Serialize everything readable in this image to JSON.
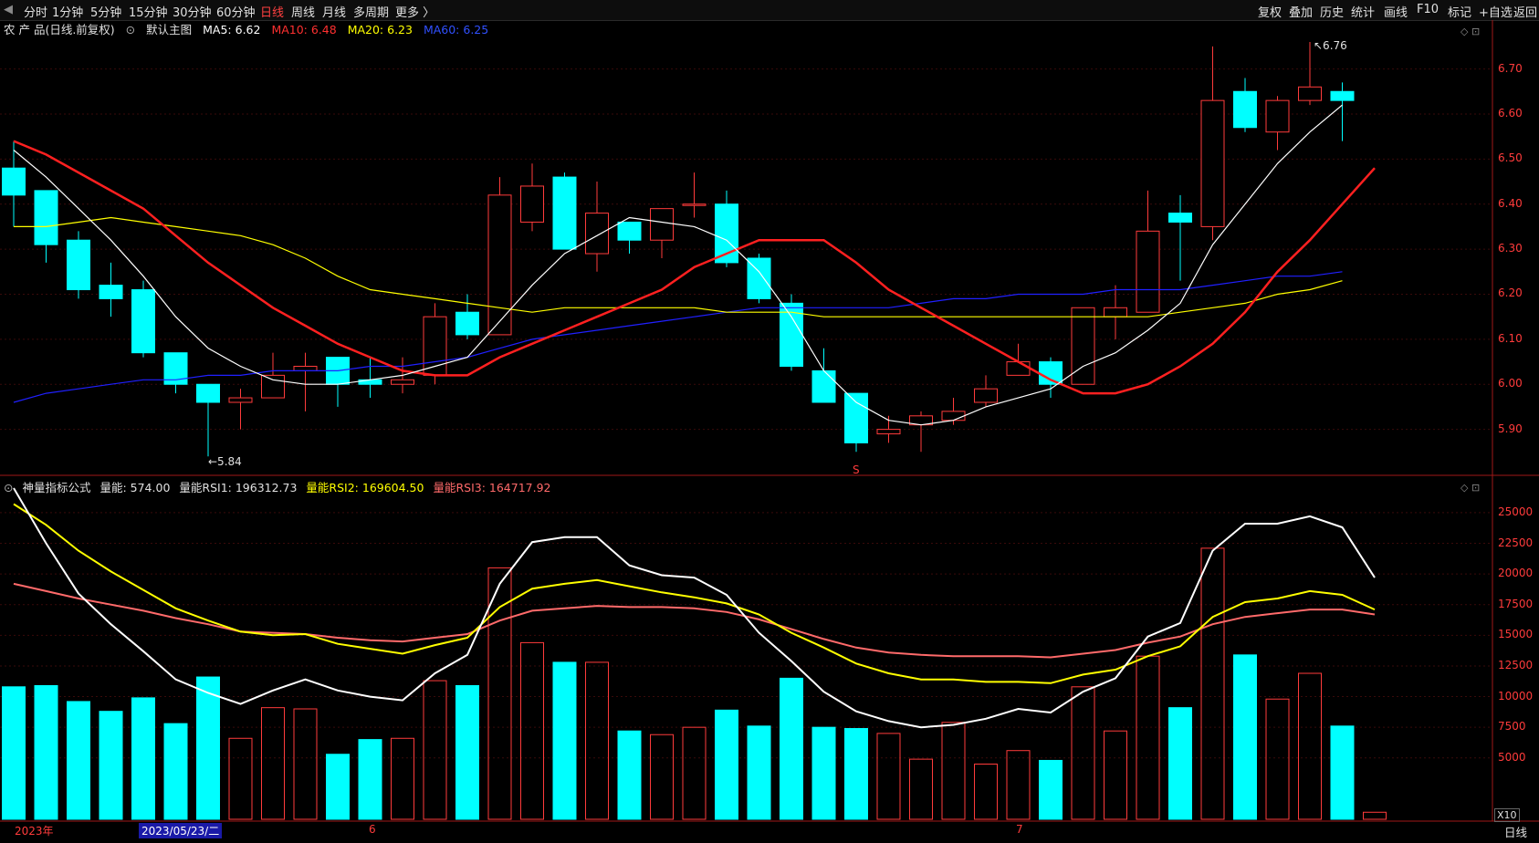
{
  "toolbar": {
    "left_items": [
      "分时",
      "1分钟",
      "5分钟",
      "15分钟",
      "30分钟",
      "60分钟",
      "日线",
      "周线",
      "月线",
      "多周期",
      "更多 〉"
    ],
    "active": "日线",
    "right_items": [
      "复权",
      "叠加",
      "历史",
      "统计",
      "画线",
      "F10",
      "标记",
      "+自选",
      "返回"
    ]
  },
  "info": {
    "stock": "农 产 品(日线.前复权)",
    "main_chart": "默认主图",
    "ma5": "MA5: 6.62",
    "ma10": "MA10: 6.48",
    "ma20": "MA20: 6.23",
    "ma60": "MA60: 6.25"
  },
  "volume_info": {
    "name": "神量指标公式",
    "vol": "量能: 574.00",
    "rsi1": "量能RSI1: 196312.73",
    "rsi2": "量能RSI2: 169604.50",
    "rsi3": "量能RSI3: 164717.92"
  },
  "colors": {
    "up": "#ff3b3b",
    "down": "#00ffff",
    "ma5": "#ffffff",
    "ma10": "#ff2020",
    "ma20": "#ffff00",
    "ma60": "#2020ff",
    "rsi1": "#ffffff",
    "rsi2": "#ffff00",
    "rsi3": "#ff6a6a"
  },
  "axis": {
    "price_ticks": [
      "6.70",
      "6.60",
      "6.50",
      "6.40",
      "6.30",
      "6.20",
      "6.10",
      "6.00",
      "5.90"
    ],
    "volume_ticks": [
      "25000",
      "22500",
      "20000",
      "17500",
      "15000",
      "12500",
      "10000",
      "7500",
      "5000"
    ],
    "x_labels": [
      "2023年",
      "2023/05/23/二",
      "6",
      "7"
    ],
    "vol_scale": "X10",
    "period": "日线"
  },
  "annotations": {
    "high": "6.76",
    "low": "5.84",
    "marker": "S"
  },
  "chart_data": [
    {
      "type": "candlestick",
      "title": "农 产 品(日线.前复权)",
      "ylim": [
        5.8,
        6.77
      ],
      "candles": [
        {
          "o": 6.48,
          "h": 6.54,
          "l": 6.35,
          "c": 6.42
        },
        {
          "o": 6.43,
          "h": 6.43,
          "l": 6.27,
          "c": 6.31
        },
        {
          "o": 6.32,
          "h": 6.34,
          "l": 6.19,
          "c": 6.21
        },
        {
          "o": 6.22,
          "h": 6.27,
          "l": 6.15,
          "c": 6.19
        },
        {
          "o": 6.21,
          "h": 6.23,
          "l": 6.06,
          "c": 6.07
        },
        {
          "o": 6.07,
          "h": 6.07,
          "l": 5.98,
          "c": 6.0
        },
        {
          "o": 6.0,
          "h": 6.0,
          "l": 5.84,
          "c": 5.96
        },
        {
          "o": 5.96,
          "h": 5.99,
          "l": 5.9,
          "c": 5.97
        },
        {
          "o": 5.97,
          "h": 6.07,
          "l": 5.97,
          "c": 6.02
        },
        {
          "o": 6.03,
          "h": 6.07,
          "l": 5.94,
          "c": 6.04
        },
        {
          "o": 6.06,
          "h": 6.06,
          "l": 5.95,
          "c": 6.0
        },
        {
          "o": 6.01,
          "h": 6.06,
          "l": 5.97,
          "c": 6.0
        },
        {
          "o": 6.0,
          "h": 6.06,
          "l": 5.98,
          "c": 6.01
        },
        {
          "o": 6.02,
          "h": 6.18,
          "l": 6.0,
          "c": 6.15
        },
        {
          "o": 6.16,
          "h": 6.2,
          "l": 6.1,
          "c": 6.11
        },
        {
          "o": 6.11,
          "h": 6.46,
          "l": 6.11,
          "c": 6.42
        },
        {
          "o": 6.36,
          "h": 6.49,
          "l": 6.34,
          "c": 6.44
        },
        {
          "o": 6.46,
          "h": 6.47,
          "l": 6.3,
          "c": 6.3
        },
        {
          "o": 6.29,
          "h": 6.45,
          "l": 6.25,
          "c": 6.38
        },
        {
          "o": 6.36,
          "h": 6.36,
          "l": 6.29,
          "c": 6.32
        },
        {
          "o": 6.32,
          "h": 6.39,
          "l": 6.28,
          "c": 6.39
        },
        {
          "o": 6.4,
          "h": 6.47,
          "l": 6.37,
          "c": 6.4
        },
        {
          "o": 6.4,
          "h": 6.43,
          "l": 6.26,
          "c": 6.27
        },
        {
          "o": 6.28,
          "h": 6.29,
          "l": 6.18,
          "c": 6.19
        },
        {
          "o": 6.18,
          "h": 6.2,
          "l": 6.03,
          "c": 6.04
        },
        {
          "o": 6.03,
          "h": 6.08,
          "l": 5.96,
          "c": 5.96
        },
        {
          "o": 5.98,
          "h": 5.98,
          "l": 5.85,
          "c": 5.87
        },
        {
          "o": 5.89,
          "h": 5.93,
          "l": 5.87,
          "c": 5.9
        },
        {
          "o": 5.91,
          "h": 5.94,
          "l": 5.85,
          "c": 5.93
        },
        {
          "o": 5.92,
          "h": 5.97,
          "l": 5.91,
          "c": 5.94
        },
        {
          "o": 5.96,
          "h": 6.02,
          "l": 5.95,
          "c": 5.99
        },
        {
          "o": 6.02,
          "h": 6.09,
          "l": 6.02,
          "c": 6.05
        },
        {
          "o": 6.05,
          "h": 6.06,
          "l": 5.97,
          "c": 6.0
        },
        {
          "o": 6.0,
          "h": 6.17,
          "l": 6.0,
          "c": 6.17
        },
        {
          "o": 6.15,
          "h": 6.22,
          "l": 6.1,
          "c": 6.17
        },
        {
          "o": 6.16,
          "h": 6.43,
          "l": 6.16,
          "c": 6.34
        },
        {
          "o": 6.38,
          "h": 6.42,
          "l": 6.23,
          "c": 6.36
        },
        {
          "o": 6.35,
          "h": 6.75,
          "l": 6.32,
          "c": 6.63
        },
        {
          "o": 6.65,
          "h": 6.68,
          "l": 6.56,
          "c": 6.57
        },
        {
          "o": 6.56,
          "h": 6.64,
          "l": 6.52,
          "c": 6.63
        },
        {
          "o": 6.63,
          "h": 6.76,
          "l": 6.62,
          "c": 6.66
        },
        {
          "o": 6.65,
          "h": 6.67,
          "l": 6.54,
          "c": 6.63
        }
      ],
      "ma5": [
        6.52,
        6.46,
        6.39,
        6.32,
        6.24,
        6.15,
        6.08,
        6.04,
        6.01,
        6.0,
        6.0,
        6.01,
        6.02,
        6.04,
        6.06,
        6.14,
        6.22,
        6.29,
        6.33,
        6.37,
        6.36,
        6.35,
        6.32,
        6.25,
        6.15,
        6.03,
        5.96,
        5.92,
        5.91,
        5.92,
        5.95,
        5.97,
        5.99,
        6.04,
        6.07,
        6.12,
        6.18,
        6.31,
        6.4,
        6.49,
        6.56,
        6.62
      ],
      "ma10": [
        6.54,
        6.51,
        6.47,
        6.43,
        6.39,
        6.33,
        6.27,
        6.22,
        6.17,
        6.13,
        6.09,
        6.06,
        6.03,
        6.02,
        6.02,
        6.06,
        6.09,
        6.12,
        6.15,
        6.18,
        6.21,
        6.26,
        6.29,
        6.32,
        6.32,
        6.32,
        6.27,
        6.21,
        6.17,
        6.13,
        6.09,
        6.05,
        6.01,
        5.98,
        5.98,
        6.0,
        6.04,
        6.09,
        6.16,
        6.25,
        6.32,
        6.4,
        6.48
      ],
      "ma20": [
        6.35,
        6.35,
        6.36,
        6.37,
        6.36,
        6.35,
        6.34,
        6.33,
        6.31,
        6.28,
        6.24,
        6.21,
        6.2,
        6.19,
        6.18,
        6.17,
        6.16,
        6.17,
        6.17,
        6.17,
        6.17,
        6.17,
        6.16,
        6.16,
        6.16,
        6.15,
        6.15,
        6.15,
        6.15,
        6.15,
        6.15,
        6.15,
        6.15,
        6.15,
        6.15,
        6.15,
        6.16,
        6.17,
        6.18,
        6.2,
        6.21,
        6.23
      ],
      "ma60": [
        5.96,
        5.98,
        5.99,
        6.0,
        6.01,
        6.01,
        6.02,
        6.02,
        6.03,
        6.03,
        6.03,
        6.04,
        6.04,
        6.05,
        6.06,
        6.08,
        6.1,
        6.11,
        6.12,
        6.13,
        6.14,
        6.15,
        6.16,
        6.17,
        6.17,
        6.17,
        6.17,
        6.17,
        6.18,
        6.19,
        6.19,
        6.2,
        6.2,
        6.2,
        6.21,
        6.21,
        6.21,
        6.22,
        6.23,
        6.24,
        6.24,
        6.25
      ]
    },
    {
      "type": "bar",
      "title": "神量指标公式",
      "ylim": [
        0,
        27000
      ],
      "values": [
        10800,
        10900,
        9600,
        8800,
        9900,
        7800,
        11600,
        6600,
        9100,
        9000,
        5300,
        6500,
        6600,
        11300,
        10900,
        20500,
        14400,
        12800,
        12800,
        7200,
        6900,
        7500,
        8900,
        7600,
        11500,
        7500,
        7400,
        7000,
        4900,
        7900,
        4500,
        5600,
        4800,
        10800,
        7200,
        13300,
        9100,
        22100,
        13400,
        9800,
        11900,
        7600,
        574
      ],
      "dir": [
        "down",
        "down",
        "down",
        "down",
        "down",
        "down",
        "down",
        "up",
        "up",
        "up",
        "down",
        "down",
        "up",
        "up",
        "down",
        "up",
        "up",
        "down",
        "up",
        "down",
        "up",
        "up",
        "down",
        "down",
        "down",
        "down",
        "down",
        "up",
        "up",
        "up",
        "up",
        "up",
        "down",
        "up",
        "up",
        "up",
        "down",
        "up",
        "down",
        "up",
        "up",
        "down",
        "up"
      ],
      "rsi1": [
        27000,
        22500,
        18400,
        15900,
        13700,
        11400,
        10300,
        9400,
        10500,
        11400,
        10500,
        10000,
        9700,
        11900,
        13400,
        19200,
        22600,
        23000,
        23000,
        20700,
        19900,
        19700,
        18300,
        15200,
        12900,
        10400,
        8800,
        8000,
        7500,
        7700,
        8200,
        9000,
        8700,
        10400,
        11500,
        14900,
        16000,
        21900,
        24100,
        24100,
        24700,
        23800,
        19700
      ],
      "rsi2": [
        25700,
        24000,
        21900,
        20200,
        18700,
        17200,
        16200,
        15300,
        15000,
        15100,
        14300,
        13900,
        13500,
        14200,
        14800,
        17300,
        18800,
        19200,
        19500,
        19000,
        18500,
        18100,
        17600,
        16700,
        15200,
        14000,
        12700,
        11900,
        11400,
        11400,
        11200,
        11200,
        11100,
        11800,
        12200,
        13300,
        14100,
        16500,
        17700,
        18000,
        18600,
        18300,
        17100
      ],
      "rsi3": [
        19200,
        18600,
        18000,
        17500,
        17000,
        16400,
        15900,
        15300,
        15200,
        15100,
        14800,
        14600,
        14500,
        14800,
        15100,
        16200,
        17000,
        17200,
        17400,
        17300,
        17300,
        17200,
        16900,
        16300,
        15500,
        14700,
        14000,
        13600,
        13400,
        13300,
        13300,
        13300,
        13200,
        13500,
        13800,
        14400,
        14900,
        15900,
        16500,
        16800,
        17100,
        17100,
        16700
      ]
    }
  ]
}
